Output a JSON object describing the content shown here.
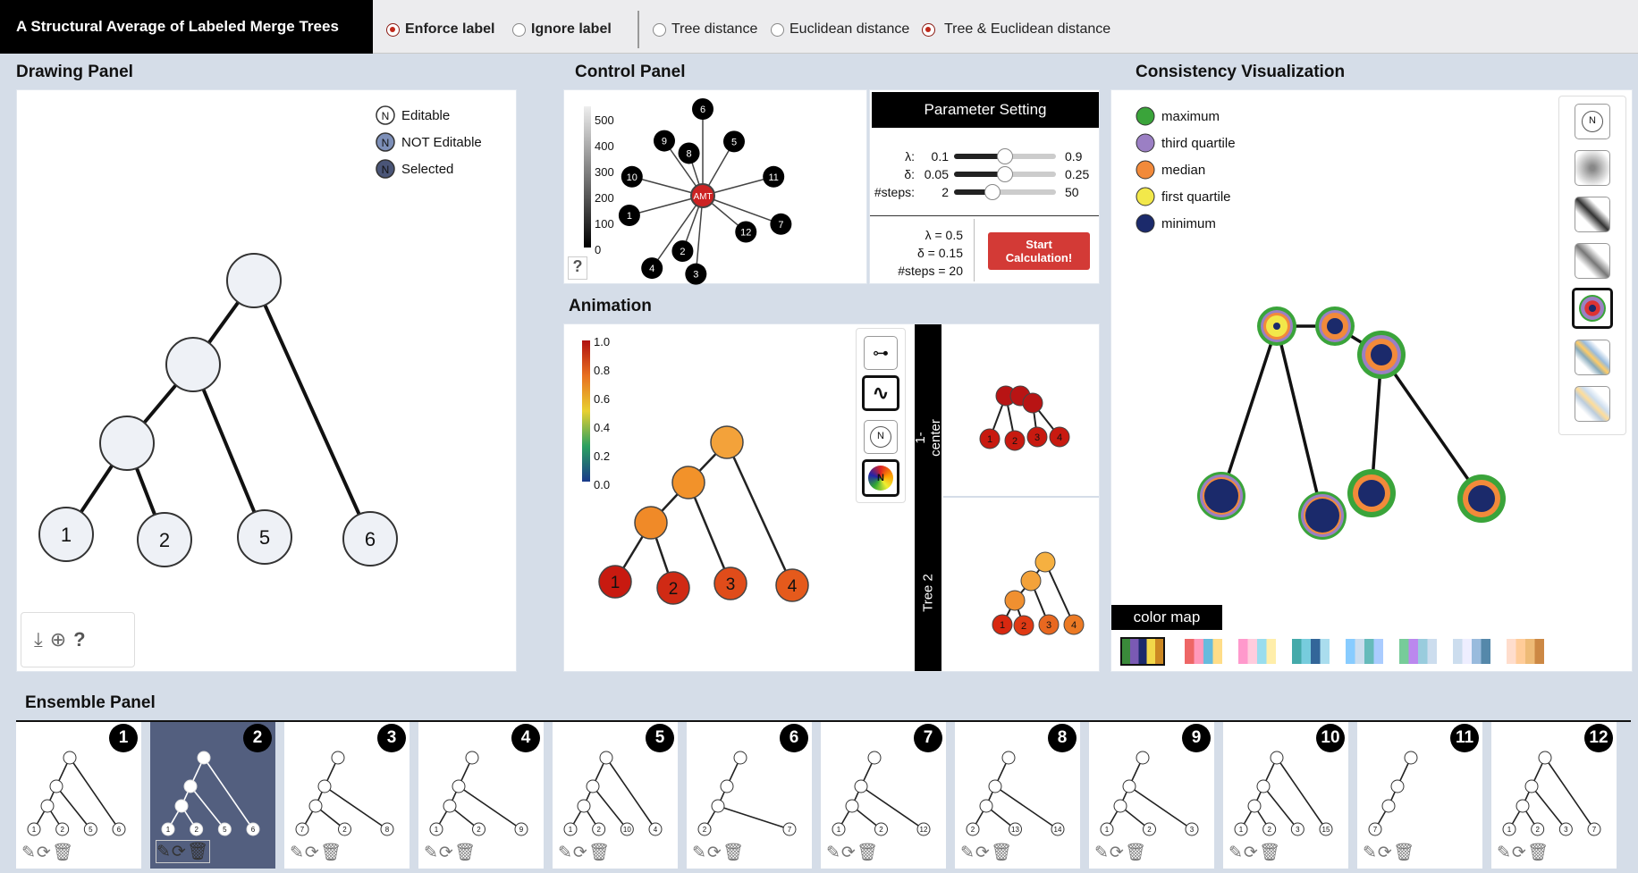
{
  "app": {
    "title": "A Structural Average of Labeled Merge Trees",
    "label_options": [
      {
        "label": "Enforce label",
        "selected": true
      },
      {
        "label": "Ignore label",
        "selected": false
      }
    ],
    "distance_options": [
      {
        "label": "Tree distance",
        "selected": false
      },
      {
        "label": "Euclidean distance",
        "selected": false
      },
      {
        "label": "Tree & Euclidean distance",
        "selected": true
      }
    ]
  },
  "drawing": {
    "title": "Drawing Panel",
    "legend": [
      {
        "label": "Editable",
        "glyph": "N"
      },
      {
        "label": "NOT Editable",
        "glyph": "N"
      },
      {
        "label": "Selected",
        "glyph": "N"
      }
    ],
    "leaves": [
      "1",
      "2",
      "5",
      "6"
    ],
    "tools": {
      "download_icon": "download-icon",
      "add_icon": "add-file-icon",
      "help": "?"
    }
  },
  "control": {
    "title": "Control Panel",
    "colorbar_ticks": [
      "500",
      "400",
      "300",
      "200",
      "100",
      "0"
    ],
    "center_label": "AMT",
    "spokes": [
      "1",
      "2",
      "3",
      "4",
      "5",
      "6",
      "7",
      "8",
      "9",
      "10",
      "11",
      "12"
    ],
    "help": "?",
    "param_title": "Parameter Setting",
    "params": [
      {
        "symbol": "λ:",
        "min": "0.1",
        "max": "0.9",
        "value": 0.5
      },
      {
        "symbol": "δ:",
        "min": "0.05",
        "max": "0.25",
        "value": 0.5
      },
      {
        "symbol": "#steps:",
        "min": "2",
        "max": "50",
        "value": 0.375
      }
    ],
    "current": [
      {
        "label": "λ =",
        "value": "0.5"
      },
      {
        "label": "δ =",
        "value": "0.15"
      },
      {
        "label": "#steps =",
        "value": "20"
      }
    ],
    "start_button": "Start Calculation!"
  },
  "animation": {
    "title": "Animation",
    "colorbar_ticks": [
      "1.0",
      "0.8",
      "0.6",
      "0.4",
      "0.2",
      "0.0"
    ],
    "leaves": [
      "1",
      "2",
      "3",
      "4"
    ],
    "side_labels": [
      "1-center",
      "Tree 2"
    ],
    "mini_leaves": [
      "1",
      "2",
      "3",
      "4"
    ],
    "buttons": [
      "path-icon",
      "curve-icon",
      "label-icon",
      "rainbow-label-icon"
    ]
  },
  "consistency": {
    "title": "Consistency Visualization",
    "legend": [
      {
        "label": "maximum",
        "color": "#3aa43a"
      },
      {
        "label": "third quartile",
        "color": "#9b7fc4"
      },
      {
        "label": "median",
        "color": "#f28a3a"
      },
      {
        "label": "first quartile",
        "color": "#f2e84a"
      },
      {
        "label": "minimum",
        "color": "#1b2a6b"
      }
    ],
    "color_map_label": "color map",
    "style_buttons": [
      "label-node-icon",
      "radial-gradient-icon",
      "diagonal-dark-icon",
      "diagonal-light-icon",
      "concentric-rings-icon",
      "diagonal-blue-icon",
      "diagonal-pastel-icon"
    ]
  },
  "ensemble": {
    "title": "Ensemble Panel",
    "cards": [
      {
        "num": "1",
        "leaves": [
          "1",
          "2",
          "5",
          "6"
        ]
      },
      {
        "num": "2",
        "leaves": [
          "1",
          "2",
          "5",
          "6"
        ]
      },
      {
        "num": "3",
        "leaves": [
          "7",
          "2",
          "8"
        ]
      },
      {
        "num": "4",
        "leaves": [
          "1",
          "2",
          "9"
        ]
      },
      {
        "num": "5",
        "leaves": [
          "1",
          "2",
          "10",
          "4"
        ]
      },
      {
        "num": "6",
        "leaves": [
          "2",
          "7"
        ]
      },
      {
        "num": "7",
        "leaves": [
          "1",
          "2",
          "12"
        ]
      },
      {
        "num": "8",
        "leaves": [
          "2",
          "13",
          "14"
        ]
      },
      {
        "num": "9",
        "leaves": [
          "1",
          "2",
          "3"
        ]
      },
      {
        "num": "10",
        "leaves": [
          "1",
          "2",
          "3",
          "15"
        ]
      },
      {
        "num": "11",
        "leaves": [
          "7"
        ]
      },
      {
        "num": "12",
        "leaves": [
          "1",
          "2",
          "3",
          "7"
        ]
      }
    ],
    "tool_icons": "✎⟳🗑"
  }
}
